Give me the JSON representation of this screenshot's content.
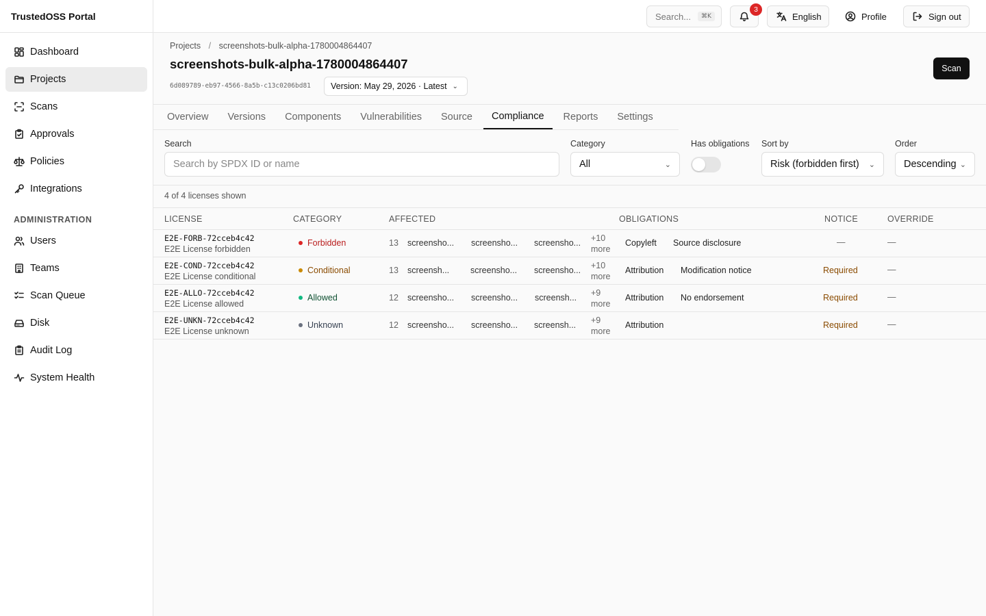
{
  "app": {
    "brand": "TrustedOSS Portal"
  },
  "sidebar": {
    "items": [
      {
        "label": "Dashboard",
        "icon": "dashboard-icon"
      },
      {
        "label": "Projects",
        "icon": "folder-icon",
        "active": true
      },
      {
        "label": "Scans",
        "icon": "scan-icon"
      },
      {
        "label": "Approvals",
        "icon": "clipboard-check-icon"
      },
      {
        "label": "Policies",
        "icon": "scale-icon"
      },
      {
        "label": "Integrations",
        "icon": "key-icon"
      }
    ],
    "admin_section": "ADMINISTRATION",
    "admin_items": [
      {
        "label": "Users",
        "icon": "users-icon"
      },
      {
        "label": "Teams",
        "icon": "building-icon"
      },
      {
        "label": "Scan Queue",
        "icon": "list-checks-icon"
      },
      {
        "label": "Disk",
        "icon": "hard-drive-icon"
      },
      {
        "label": "Audit Log",
        "icon": "clipboard-list-icon"
      },
      {
        "label": "System Health",
        "icon": "activity-icon"
      }
    ]
  },
  "topbar": {
    "search_label": "Search...",
    "search_shortcut": "⌘K",
    "notifications_count": "3",
    "language": "English",
    "profile": "Profile",
    "sign_out": "Sign out"
  },
  "header": {
    "breadcrumb_root": "Projects",
    "breadcrumb_sep": "/",
    "breadcrumb_current": "screenshots-bulk-alpha-1780004864407",
    "title": "screenshots-bulk-alpha-1780004864407",
    "uuid": "6d089789-eb97-4566-8a5b-c13c0206bd81",
    "version": "Version: May 29, 2026 · Latest",
    "scan_button": "Scan"
  },
  "tabs": [
    {
      "label": "Overview"
    },
    {
      "label": "Versions"
    },
    {
      "label": "Components"
    },
    {
      "label": "Vulnerabilities"
    },
    {
      "label": "Source"
    },
    {
      "label": "Compliance",
      "active": true
    },
    {
      "label": "Reports"
    },
    {
      "label": "Settings"
    }
  ],
  "filters": {
    "search_label": "Search",
    "search_placeholder": "Search by SPDX ID or name",
    "category_label": "Category",
    "category_value": "All",
    "obligations_label": "Has obligations",
    "obligations_on": false,
    "sort_label": "Sort by",
    "sort_value": "Risk (forbidden first)",
    "order_label": "Order",
    "order_value": "Descending"
  },
  "summary": "4 of 4 licenses shown",
  "table": {
    "headers": [
      "LICENSE",
      "CATEGORY",
      "AFFECTED",
      "OBLIGATIONS",
      "NOTICE",
      "OVERRIDE"
    ],
    "rows": [
      {
        "spdx": "E2E-FORB-72cceb4c42",
        "name": "E2E License forbidden",
        "category": "Forbidden",
        "category_color": "#dc2626",
        "category_text_color": "#b91c1c",
        "affected_count": "13",
        "affected": [
          "screensho...",
          "screensho...",
          "screensho..."
        ],
        "more_1": "+10",
        "more_2": "more",
        "obligations": [
          "Copyleft",
          "Source disclosure"
        ],
        "notice": "—",
        "override": "—"
      },
      {
        "spdx": "E2E-COND-72cceb4c42",
        "name": "E2E License conditional",
        "category": "Conditional",
        "category_color": "#ca8a04",
        "category_text_color": "#8a4b00",
        "affected_count": "13",
        "affected": [
          "screensh...",
          "screensho...",
          "screensho..."
        ],
        "more_1": "+10",
        "more_2": "more",
        "obligations": [
          "Attribution",
          "Modification notice"
        ],
        "notice": "Required",
        "override": "—"
      },
      {
        "spdx": "E2E-ALLO-72cceb4c42",
        "name": "E2E License allowed",
        "category": "Allowed",
        "category_color": "#10b981",
        "category_text_color": "#0f5132",
        "affected_count": "12",
        "affected": [
          "screensho...",
          "screensho...",
          "screensh..."
        ],
        "more_1": "+9",
        "more_2": "more",
        "obligations": [
          "Attribution",
          "No endorsement"
        ],
        "notice": "Required",
        "override": "—"
      },
      {
        "spdx": "E2E-UNKN-72cceb4c42",
        "name": "E2E License unknown",
        "category": "Unknown",
        "category_color": "#6b7280",
        "category_text_color": "#374151",
        "affected_count": "12",
        "affected": [
          "screensho...",
          "screensho...",
          "screensh..."
        ],
        "more_1": "+9",
        "more_2": "more",
        "obligations": [
          "Attribution",
          ""
        ],
        "notice": "Required",
        "override": "—"
      }
    ]
  }
}
